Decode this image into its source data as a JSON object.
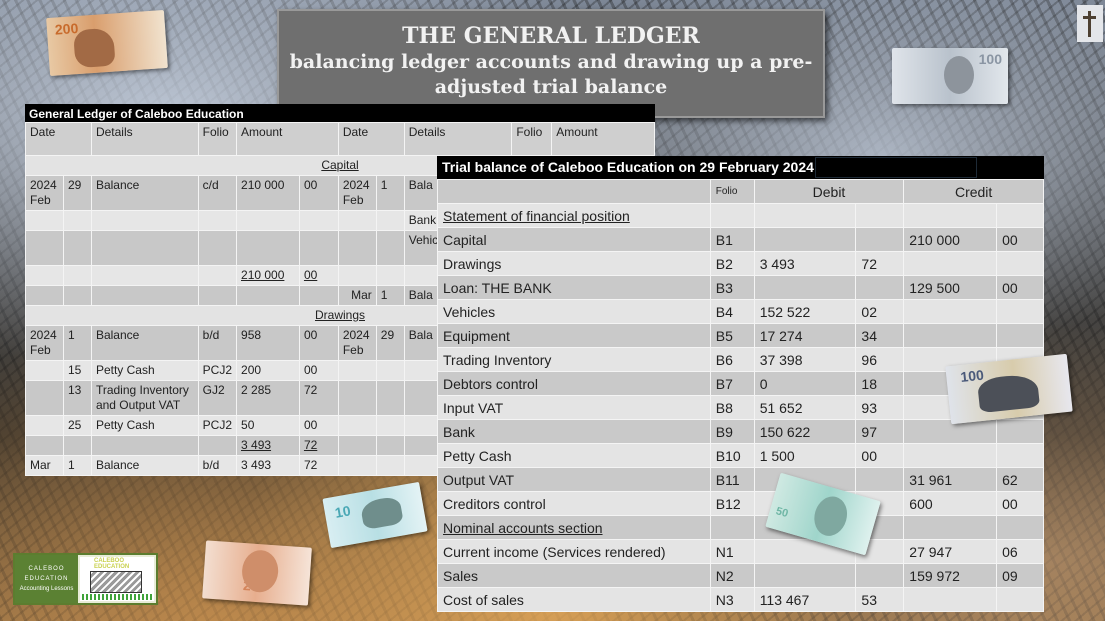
{
  "title": {
    "line1": "THE GENERAL LEDGER",
    "line2": "balancing ledger accounts and drawing up a pre-",
    "line3": "adjusted trial balance"
  },
  "ledger": {
    "title": "General Ledger of Caleboo Education",
    "headers": [
      "Date",
      "Details",
      "Folio",
      "Amount",
      "Date",
      "Details",
      "Folio",
      "Amount"
    ],
    "capital": {
      "name": "Capital",
      "rows": [
        {
          "year": "2024 Feb",
          "day": "29",
          "details": "Balance",
          "folio": "c/d",
          "amount": "210 000",
          "cents": "00",
          "r_year": "2024 Feb",
          "r_day": "1",
          "r_details": "Bala"
        },
        {
          "r_details": "Bank"
        },
        {
          "r_details": "Vehic Input"
        },
        {
          "amount": "210 000",
          "cents": "00",
          "total": true
        },
        {
          "r_year": "Mar",
          "r_day": "1",
          "r_details": "Bala"
        }
      ]
    },
    "drawings": {
      "name": "Drawings",
      "rows": [
        {
          "year": "2024 Feb",
          "day": "1",
          "details": "Balance",
          "folio": "b/d",
          "amount": "958",
          "cents": "00",
          "r_year": "2024 Feb",
          "r_day": "29",
          "r_details": "Bala"
        },
        {
          "day": "15",
          "details": "Petty Cash",
          "folio": "PCJ2",
          "amount": "200",
          "cents": "00"
        },
        {
          "day": "13",
          "details": "Trading Inventory and Output VAT",
          "folio": "GJ2",
          "amount": "2 285",
          "cents": "72"
        },
        {
          "day": "25",
          "details": "Petty Cash",
          "folio": "PCJ2",
          "amount": "50",
          "cents": "00"
        },
        {
          "amount": "3 493",
          "cents": "72",
          "total": true
        },
        {
          "year": "Mar",
          "day": "1",
          "details": "Balance",
          "folio": "b/d",
          "amount": "3 493",
          "cents": "72"
        }
      ]
    }
  },
  "trial_balance": {
    "title": "Trial balance of Caleboo Education on 29 February 2024",
    "headers": {
      "folio": "Folio",
      "debit": "Debit",
      "credit": "Credit"
    },
    "rows": [
      {
        "label": "Statement of financial position",
        "section": true
      },
      {
        "label": "Capital",
        "folio": "B1",
        "debit": "",
        "debit_c": "",
        "credit": "210 000",
        "credit_c": "00"
      },
      {
        "label": "Drawings",
        "folio": "B2",
        "debit": "3 493",
        "debit_c": "72",
        "credit": "",
        "credit_c": ""
      },
      {
        "label": "Loan: THE BANK",
        "folio": "B3",
        "debit": "",
        "debit_c": "",
        "credit": "129 500",
        "credit_c": "00"
      },
      {
        "label": "Vehicles",
        "folio": "B4",
        "debit": "152 522",
        "debit_c": "02",
        "credit": "",
        "credit_c": ""
      },
      {
        "label": "Equipment",
        "folio": "B5",
        "debit": "17 274",
        "debit_c": "34",
        "credit": "",
        "credit_c": ""
      },
      {
        "label": "Trading Inventory",
        "folio": "B6",
        "debit": "37 398",
        "debit_c": "96",
        "credit": "",
        "credit_c": ""
      },
      {
        "label": "Debtors control",
        "folio": "B7",
        "debit": "0",
        "debit_c": "18",
        "credit": "",
        "credit_c": ""
      },
      {
        "label": "Input VAT",
        "folio": "B8",
        "debit": "51 652",
        "debit_c": "93",
        "credit": "",
        "credit_c": ""
      },
      {
        "label": "Bank",
        "folio": "B9",
        "debit": "150 622",
        "debit_c": "97",
        "credit": "",
        "credit_c": ""
      },
      {
        "label": "Petty Cash",
        "folio": "B10",
        "debit": "1 500",
        "debit_c": "00",
        "credit": "",
        "credit_c": ""
      },
      {
        "label": "Output VAT",
        "folio": "B11",
        "debit": "",
        "debit_c": "",
        "credit": "31 961",
        "credit_c": "62"
      },
      {
        "label": "Creditors control",
        "folio": "B12",
        "debit": "",
        "debit_c": "",
        "credit": "600",
        "credit_c": "00"
      },
      {
        "label": "Nominal accounts section",
        "section": true
      },
      {
        "label": "Current income (Services rendered)",
        "folio": "N1",
        "debit": "",
        "debit_c": "",
        "credit": "27 947",
        "credit_c": "06"
      },
      {
        "label": "Sales",
        "folio": "N2",
        "debit": "",
        "debit_c": "",
        "credit": "159 972",
        "credit_c": "09"
      },
      {
        "label": "Cost of sales",
        "folio": "N3",
        "debit": "113 467",
        "debit_c": "53",
        "credit": "",
        "credit_c": ""
      }
    ]
  },
  "decorations": {
    "banknotes": [
      {
        "name": "r200-note",
        "value": "200"
      },
      {
        "name": "r100-note-top",
        "value": "100"
      },
      {
        "name": "r100-note-right",
        "value": "100"
      },
      {
        "name": "r10-note",
        "value": "10"
      },
      {
        "name": "r20-note",
        "value": "20"
      },
      {
        "name": "r50-note",
        "value": "50"
      }
    ]
  },
  "logo": {
    "line1": "CALEBOO",
    "line2": "EDUCATION",
    "line3": "Accounting Lessons",
    "sign": "CALEBOO EDUCATION"
  }
}
